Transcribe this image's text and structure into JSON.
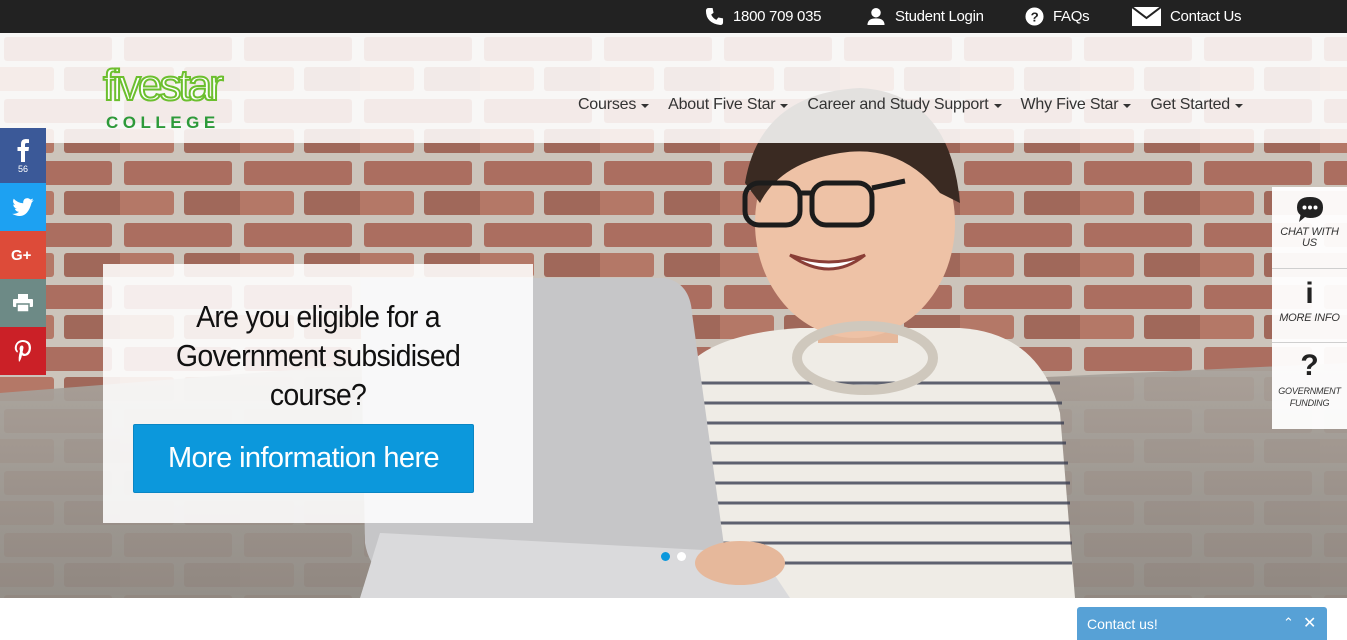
{
  "topbar": {
    "phone": "1800 709 035",
    "student_login": "Student Login",
    "faqs": "FAQs",
    "contact": "Contact Us"
  },
  "logo": {
    "line1": "fivestar",
    "line2": "COLLEGE"
  },
  "nav": {
    "items": [
      {
        "label": "Courses"
      },
      {
        "label": "About Five Star"
      },
      {
        "label": "Career and Study Support"
      },
      {
        "label": "Why Five Star"
      },
      {
        "label": "Get Started"
      }
    ]
  },
  "social": {
    "facebook_count": "56",
    "icons": [
      "facebook-icon",
      "twitter-icon",
      "google-plus-icon",
      "print-icon",
      "pinterest-icon"
    ]
  },
  "hero": {
    "headline": "Are you eligible for a Government subsidised course?",
    "button": "More information here",
    "slides": 2,
    "active_slide": 1
  },
  "right_panel": {
    "chat": "CHAT WITH US",
    "info": "MORE INFO",
    "government": "GOVERNMENT FUNDING"
  },
  "contact_widget": {
    "label": "Contact us!"
  },
  "colors": {
    "topbar": "#222222",
    "accent_blue": "#0c98dc",
    "logo_green": "#6cbf2e",
    "facebook": "#3b5998",
    "twitter": "#1da1f2",
    "google_plus": "#dd4b39",
    "print": "#6d8a86",
    "pinterest": "#cb2027",
    "contact_widget": "#57a1d6"
  }
}
